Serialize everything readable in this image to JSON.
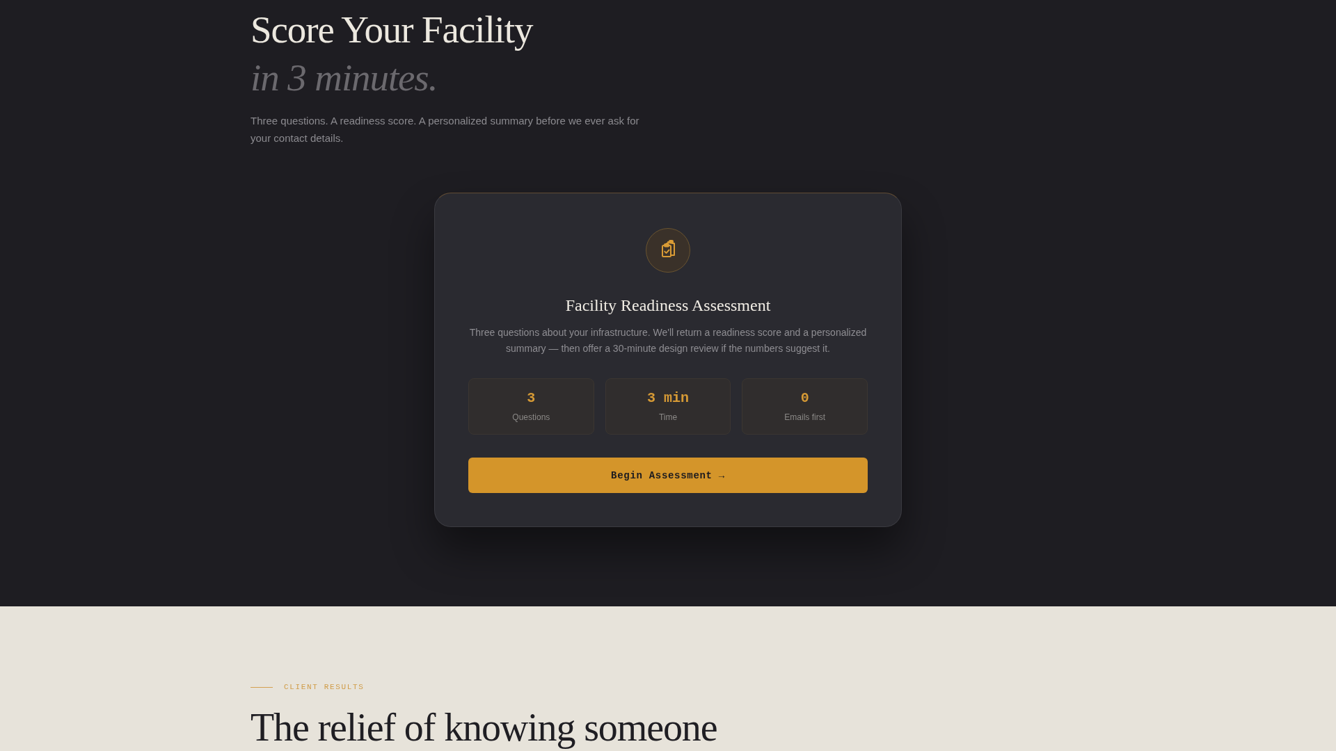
{
  "hero": {
    "title": "Score Your Facility",
    "title_emphasis": "in 3 minutes.",
    "intro": "Three questions. A readiness score. A personalized summary before we ever ask for your contact details."
  },
  "assessment_card": {
    "title": "Facility Readiness Assessment",
    "description": "Three questions about your infrastructure. We'll return a readiness score and a personalized summary — then offer a 30-minute design review if the numbers suggest it.",
    "stats": [
      {
        "value": "3",
        "label": "Questions"
      },
      {
        "value": "3 min",
        "label": "Time"
      },
      {
        "value": "0",
        "label": "Emails first"
      }
    ],
    "button": "Begin Assessment →"
  },
  "client_results": {
    "eyebrow": "CLIENT RESULTS",
    "heading": "The relief of knowing someone"
  }
}
